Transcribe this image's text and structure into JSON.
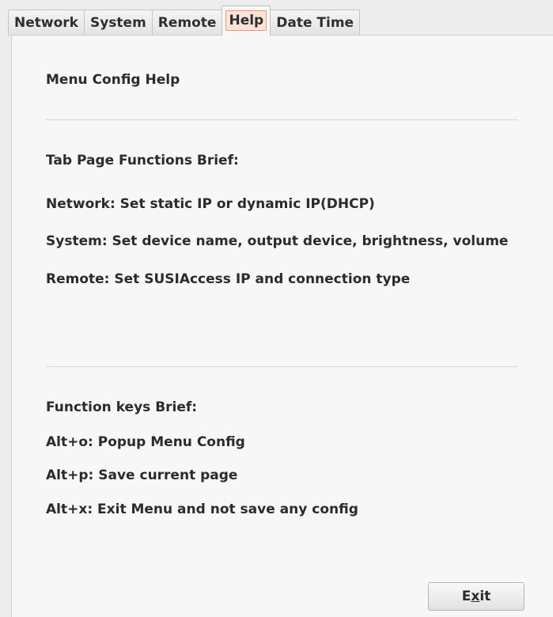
{
  "tabs": {
    "network": "Network",
    "system": "System",
    "remote": "Remote",
    "help": "Help",
    "datetime": "Date Time"
  },
  "help": {
    "title": "Menu Config Help",
    "tab_brief_heading": "Tab Page Functions Brief:",
    "network_line": "Network:  Set static IP or dynamic IP(DHCP)",
    "system_line": "System:  Set device name, output device, brightness, volume",
    "remote_line": "Remote:  Set  SUSIAccess IP and connection type",
    "keys_heading": "Function keys Brief:",
    "alt_o": "Alt+o: Popup Menu Config",
    "alt_p": "Alt+p: Save current page",
    "alt_x": "Alt+x: Exit  Menu and not save any config"
  },
  "footer": {
    "exit_pre": "E",
    "exit_mnemonic": "x",
    "exit_post": "it"
  }
}
